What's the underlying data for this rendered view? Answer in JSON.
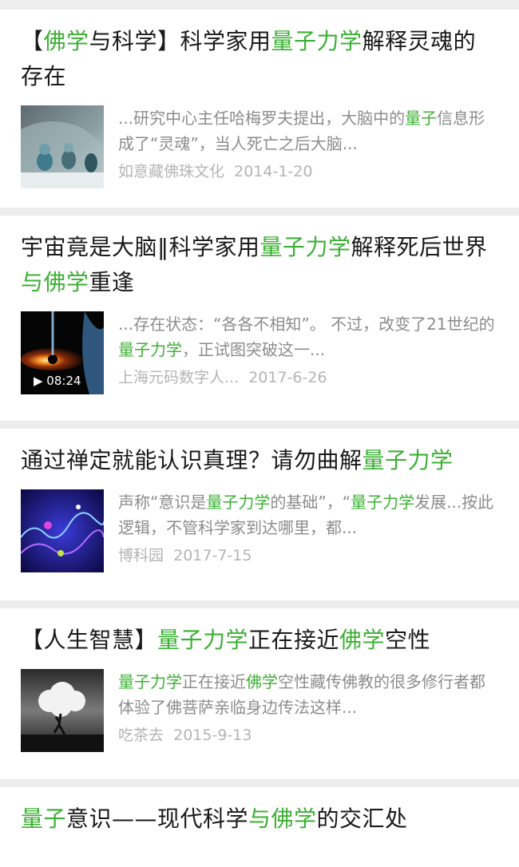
{
  "results": [
    {
      "title": [
        {
          "t": "【"
        },
        {
          "t": "佛学",
          "hl": true
        },
        {
          "t": "与科学】科学家用"
        },
        {
          "t": "量子力学",
          "hl": true
        },
        {
          "t": "解释灵魂的存在"
        }
      ],
      "snippet": [
        {
          "t": "...研究中心主任哈梅罗夫提出，大脑中的"
        },
        {
          "t": "量子",
          "hl": true
        },
        {
          "t": "信息形成了“灵魂”，当人死亡之后大脑..."
        }
      ],
      "source": "如意藏佛珠文化",
      "date": "2014-1-20",
      "thumb": "surgery-photo"
    },
    {
      "title": [
        {
          "t": "宇宙竟是大脑‖科学家用"
        },
        {
          "t": "量子力学",
          "hl": true
        },
        {
          "t": "解释死后世界"
        },
        {
          "t": "与佛学",
          "hl": true
        },
        {
          "t": "重逢"
        }
      ],
      "snippet": [
        {
          "t": "...存在状态：“各各不相知”。 不过，改变了21世纪的"
        },
        {
          "t": "量子力学",
          "hl": true
        },
        {
          "t": "，正试图突破这一..."
        }
      ],
      "source": "上海元码数字人...",
      "date": "2017-6-26",
      "thumb": "black-hole-video",
      "duration": "▶ 08:24"
    },
    {
      "title": [
        {
          "t": "通过禅定就能认识真理？请勿曲解"
        },
        {
          "t": "量子力学",
          "hl": true
        }
      ],
      "snippet": [
        {
          "t": "声称“意识是"
        },
        {
          "t": "量子力学",
          "hl": true
        },
        {
          "t": "的基础”，“"
        },
        {
          "t": "量子力学",
          "hl": true
        },
        {
          "t": "发展...按此逻辑，不管科学家到达哪里，都..."
        }
      ],
      "source": "博科园",
      "date": "2017-7-15",
      "thumb": "quantum-waves"
    },
    {
      "title": [
        {
          "t": "【人生智慧】"
        },
        {
          "t": "量子力学",
          "hl": true
        },
        {
          "t": "正在接近"
        },
        {
          "t": "佛学",
          "hl": true
        },
        {
          "t": "空性"
        }
      ],
      "snippet": [
        {
          "t": "量子力学",
          "hl": true
        },
        {
          "t": "正在接近"
        },
        {
          "t": "佛学",
          "hl": true
        },
        {
          "t": "空性藏传佛教的很多修行者都体验了佛菩萨亲临身边传法这样..."
        }
      ],
      "source": "吃茶去",
      "date": "2015-9-13",
      "thumb": "cloud-tree"
    },
    {
      "title": [
        {
          "t": "量子",
          "hl": true
        },
        {
          "t": "意识——现代科学"
        },
        {
          "t": "与佛学",
          "hl": true
        },
        {
          "t": "的交汇处"
        }
      ]
    }
  ],
  "colors": {
    "highlight": "#3cb034",
    "snippet": "#8c8c8c",
    "meta": "#b4b4b4"
  }
}
